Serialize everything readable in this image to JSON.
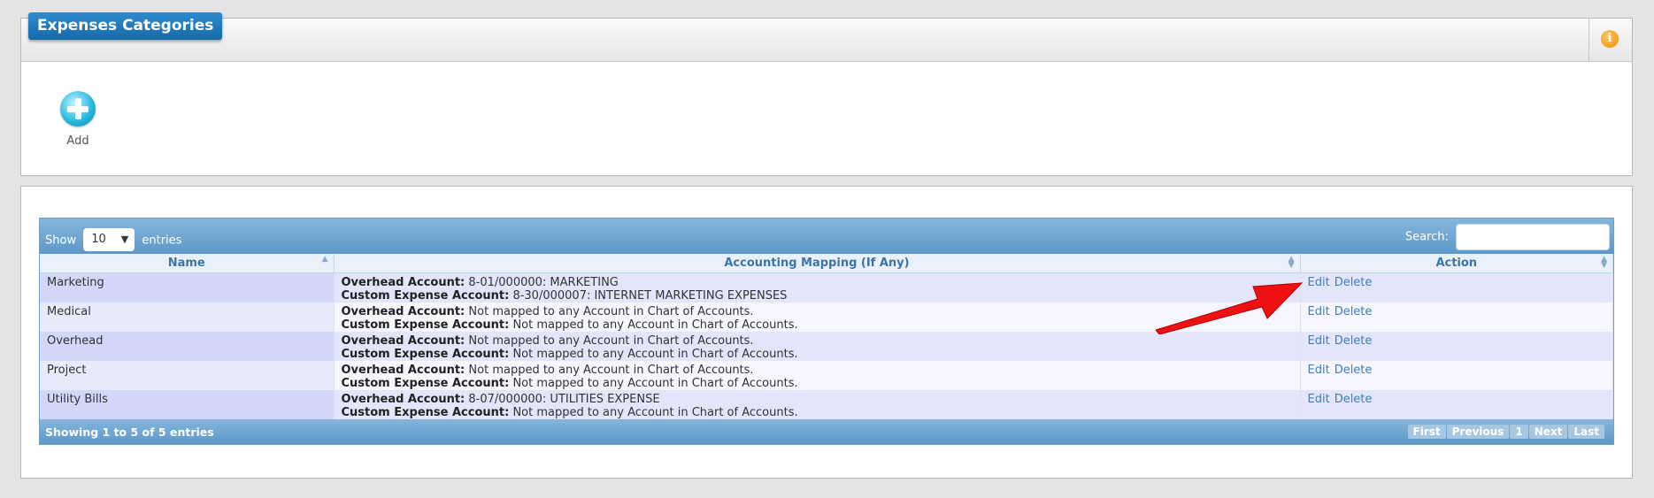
{
  "header": {
    "title": "Expenses Categories",
    "info_icon": "i"
  },
  "toolbar": {
    "add_label": "Add"
  },
  "table": {
    "length": {
      "show_label": "Show",
      "value": "10",
      "entries_label": "entries"
    },
    "search_label": "Search:",
    "columns": [
      "Name",
      "Accounting Mapping (If Any)",
      "Action"
    ],
    "overhead_label": "Overhead Account:",
    "custom_label": "Custom Expense Account:",
    "rows": [
      {
        "name": "Marketing",
        "overhead": "8-01/000000: MARKETING",
        "custom": "8-30/000007: INTERNET MARKETING EXPENSES",
        "edit": "Edit",
        "delete": "Delete"
      },
      {
        "name": "Medical",
        "overhead": "Not mapped to any Account in Chart of Accounts.",
        "custom": "Not mapped to any Account in Chart of Accounts.",
        "edit": "Edit",
        "delete": "Delete"
      },
      {
        "name": "Overhead",
        "overhead": "Not mapped to any Account in Chart of Accounts.",
        "custom": "Not mapped to any Account in Chart of Accounts.",
        "edit": "Edit",
        "delete": "Delete"
      },
      {
        "name": "Project",
        "overhead": "Not mapped to any Account in Chart of Accounts.",
        "custom": "Not mapped to any Account in Chart of Accounts.",
        "edit": "Edit",
        "delete": "Delete"
      },
      {
        "name": "Utility Bills",
        "overhead": "8-07/000000: UTILITIES EXPENSE",
        "custom": "Not mapped to any Account in Chart of Accounts.",
        "edit": "Edit",
        "delete": "Delete"
      }
    ],
    "info": "Showing 1 to 5 of 5 entries",
    "pager": {
      "first": "First",
      "previous": "Previous",
      "current": "1",
      "next": "Next",
      "last": "Last"
    }
  },
  "colors": {
    "title_bg": "#1e76ba",
    "table_bar": "#6fa5d1",
    "row_odd": "#e3e5fb",
    "row_even": "#f6f6fe",
    "link": "#3b7fc0",
    "arrow": "#ee1111"
  },
  "icons": [
    "info-icon",
    "add-icon",
    "sort-icon",
    "red-arrow-annotation"
  ]
}
